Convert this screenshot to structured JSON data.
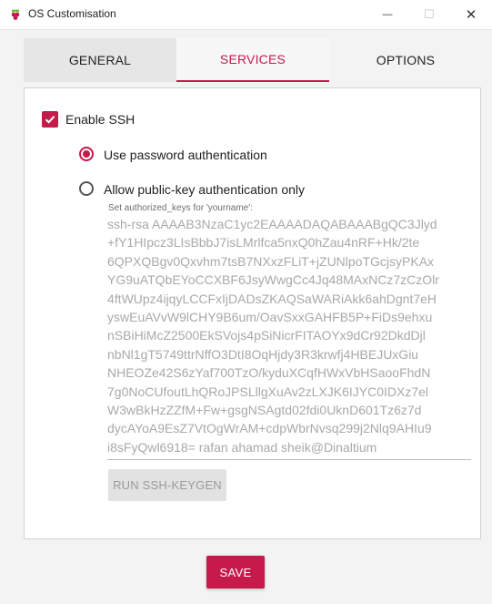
{
  "window": {
    "title": "OS Customisation",
    "minimize_glyph": "—",
    "maximize_glyph": "☐",
    "close_glyph": "✕"
  },
  "tabs": [
    {
      "label": "GENERAL",
      "selected": false
    },
    {
      "label": "SERVICES",
      "selected": true
    },
    {
      "label": "OPTIONS",
      "selected": false
    }
  ],
  "services": {
    "enable_ssh_label": "Enable SSH",
    "enable_ssh_checked": true,
    "auth_options": [
      {
        "label": "Use password authentication",
        "selected": true
      },
      {
        "label": "Allow public-key authentication only",
        "selected": false
      }
    ],
    "authorized_keys_label": "Set authorized_keys for 'yourname':",
    "authorized_keys_lines": [
      "ssh-rsa AAAAB3NzaC1yc2EAAAADAQABAAABgQC3Jlyd",
      "+fY1HIpcz3LIsBbbJ7isLMrlfca5nxQ0hZau4nRF+Hk/2te",
      "6QPXQBgv0Qxvhm7tsB7NXxzFLiT+jZUNlpoTGcjsyPKAx",
      "YG9uATQbEYoCCXBF6JsyWwgCc4Jq48MAxNCz7zCzOlr",
      "4ftWUpz4ijqyLCCFxIjDADsZKAQSaWARiAkk6ahDgnt7eH",
      "yswEuAVvW9lCHY9B6um/OavSxxGAHFB5P+FiDs9ehxu",
      "nSBiHiMcZ2500EkSVojs4pSiNicrFITAOYx9dCr92DkdDjl",
      "nbNl1gT5749ttrNffO3DtI8OqHjdy3R3krwfj4HBEJUxGiu",
      "NHEOZe42S6zYaf700TzO/kyduXCqfHWxVbHSaooFhdN",
      "7g0NoCUfoutLhQRoJPSLllgXuAv2zLXJK6IJYC0IDXz7el",
      "W3wBkHzZZfM+Fw+gsgNSAgtd02fdi0UknD601Tz6z7d",
      "dycAYoA9EsZ7VtOgWrAM+cdpWbrNvsq299j2Nlq9AHIu9",
      "i8sFyQwl6918= rafan ahamad sheik@Dinaltium"
    ],
    "keygen_button": "RUN SSH-KEYGEN"
  },
  "footer": {
    "save_button": "SAVE"
  },
  "colors": {
    "accent": "#c51a4a",
    "panel_bg": "#ffffff",
    "window_bg": "#f3f3f3"
  }
}
